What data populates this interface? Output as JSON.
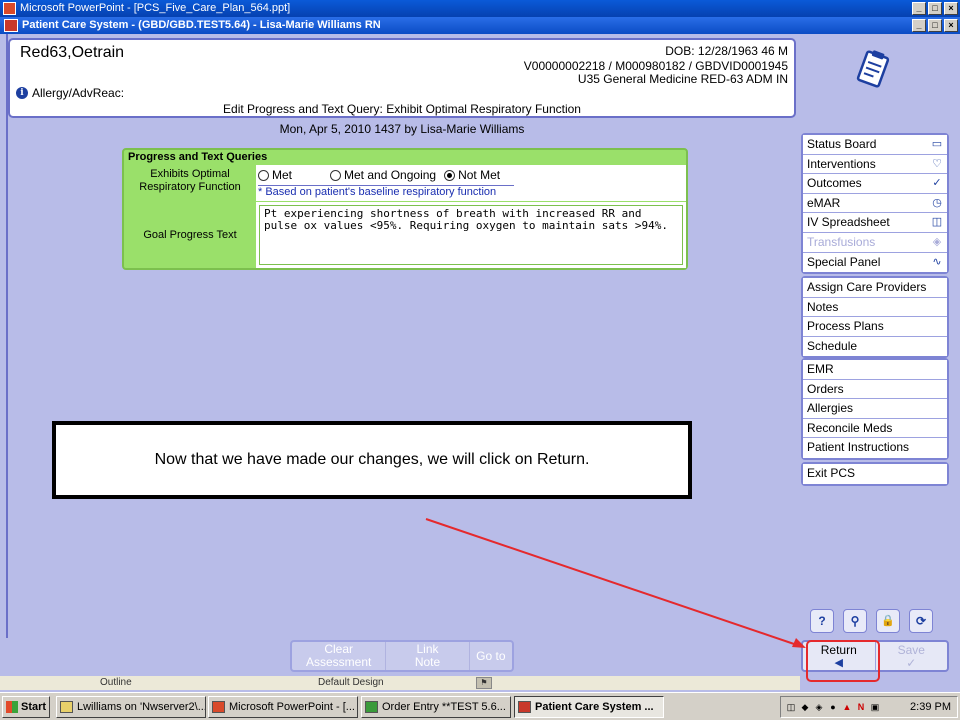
{
  "ppt_window": {
    "title": "Microsoft PowerPoint - [PCS_Five_Care_Plan_564.ppt]"
  },
  "pcs_window": {
    "title": "Patient Care System - (GBD/GBD.TEST5.64) - Lisa-Marie Williams RN"
  },
  "window_buttons": {
    "minimize": "_",
    "maximize": "□",
    "close": "×"
  },
  "patient": {
    "name": "Red63,Oetrain",
    "dob_line": "DOB: 12/28/1963 46 M",
    "account_line": "V00000002218 / M000980182 / GBDVID0001945",
    "unit_line": "U35 General Medicine  RED-63  ADM IN",
    "allergy_label": "Allergy/AdvReac:"
  },
  "edit_title": "Edit Progress and Text Query:  Exhibit Optimal Respiratory Function",
  "entry_line": "Mon,  Apr 5, 2010 1437  by  Lisa-Marie Williams",
  "query_panel": {
    "header": "Progress and Text Queries",
    "row1_label": "Exhibits Optimal Respiratory Function",
    "options": [
      "Met",
      "Met and Ongoing",
      "Not Met"
    ],
    "selected": "Not Met",
    "baseline_note": "* Based on patient's baseline respiratory function",
    "row2_label": "Goal Progress Text",
    "goal_text": "Pt experiencing shortness of breath with increased RR and pulse ox values <95%. Requiring oxygen to maintain sats >94%."
  },
  "callout": {
    "text": "Now that we have made our changes, we will click on Return."
  },
  "sidebar": {
    "group1": [
      {
        "label": "Status Board",
        "icon": "book-icon"
      },
      {
        "label": "Interventions",
        "icon": "interventions-icon"
      },
      {
        "label": "Outcomes",
        "icon": "outcomes-icon"
      },
      {
        "label": "eMAR",
        "icon": "emar-icon"
      },
      {
        "label": "IV Spreadsheet",
        "icon": "iv-icon"
      },
      {
        "label": "Transfusions",
        "icon": "transfusion-icon"
      },
      {
        "label": "Special Panel",
        "icon": "waveform-icon"
      }
    ],
    "group2": [
      "Assign Care Providers",
      "Notes",
      "Process Plans",
      "Schedule"
    ],
    "group3": [
      "EMR",
      "Orders",
      "Allergies",
      "Reconcile Meds",
      "Patient Instructions"
    ],
    "group4": [
      "Exit PCS"
    ]
  },
  "icon_buttons": {
    "help": "?",
    "search": "⚲",
    "lock": "🔒",
    "refresh": "⟳"
  },
  "actions": {
    "return_label": "Return",
    "save_label": "Save",
    "return_glyph": "◆",
    "save_glyph": "✓"
  },
  "bottom_toolbar": {
    "clear_label": "Clear Assessment",
    "link_label": "Link Note",
    "goto_label": "Go to"
  },
  "ppt_viewbar": {
    "outline": "Outline",
    "design": "Default Design"
  },
  "taskbar": {
    "start": "Start",
    "tasks": [
      "Lwilliams on 'Nwserver2\\...",
      "Microsoft PowerPoint - [...",
      "Order Entry **TEST 5.6...",
      "Patient Care System ..."
    ],
    "clock": "2:39 PM",
    "tray_n": "N"
  },
  "colors": {
    "accent": "#0b4cc4",
    "panel_green": "#9ae06a",
    "highlight_red": "#e5292d",
    "workspace": "#b8bce8"
  }
}
